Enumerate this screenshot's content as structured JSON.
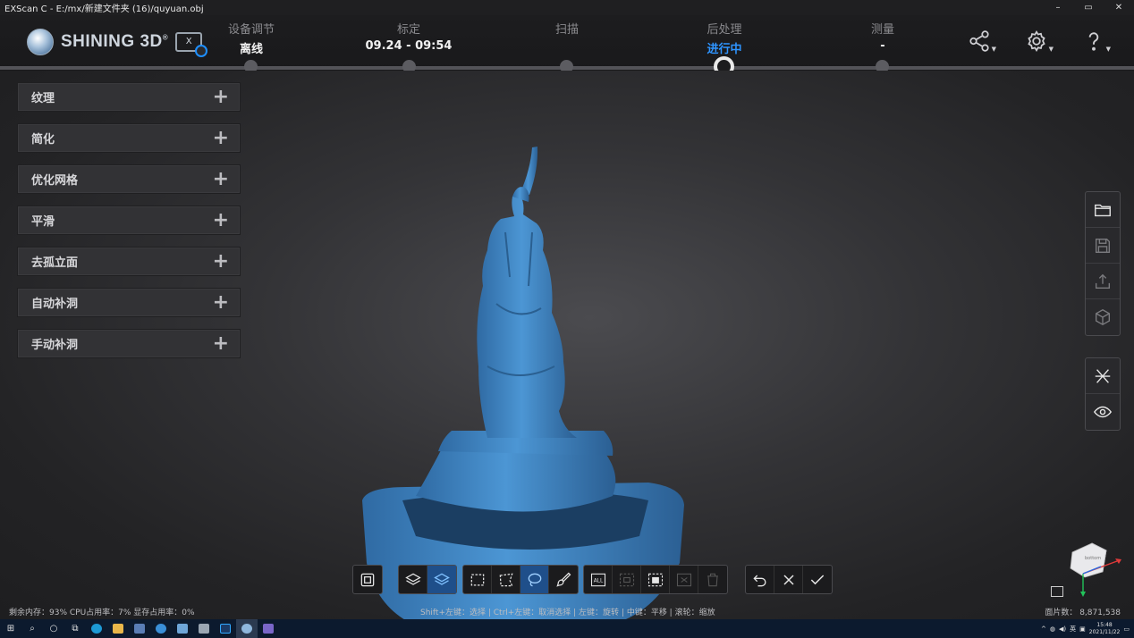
{
  "window": {
    "title": "EXScan C  -  E:/mx/新建文件夹 (16)/quyuan.obj",
    "controls": [
      "–",
      "▭",
      "✕"
    ]
  },
  "logo": {
    "brand": "SHINING 3D",
    "mark": "®"
  },
  "steps": [
    {
      "label": "设备调节",
      "value": "离线",
      "active": false
    },
    {
      "label": "标定",
      "value": "09.24 - 09:54",
      "active": false
    },
    {
      "label": "扫描",
      "value": "",
      "active": false
    },
    {
      "label": "后处理",
      "value": "进行中",
      "active": true
    },
    {
      "label": "测量",
      "value": "-",
      "active": false
    }
  ],
  "header_icons": [
    "share-icon",
    "gear-icon",
    "help-icon"
  ],
  "tools": [
    {
      "label": "纹理",
      "action": "+"
    },
    {
      "label": "简化",
      "action": "+"
    },
    {
      "label": "优化网格",
      "action": "+"
    },
    {
      "label": "平滑",
      "action": "+"
    },
    {
      "label": "去孤立面",
      "action": "+"
    },
    {
      "label": "自动补洞",
      "action": "+"
    },
    {
      "label": "手动补洞",
      "action": "+"
    }
  ],
  "right_panel_top": [
    "folder-icon",
    "save-icon",
    "export-icon",
    "cube-icon"
  ],
  "right_panel_bottom": [
    "mesh-icon",
    "eye-icon"
  ],
  "bottom_toolbar": {
    "groups": [
      [
        "view-fit-icon"
      ],
      [
        "layers-icon",
        "layers-selected-icon"
      ],
      [
        "rect-select-icon",
        "polygon-select-icon",
        "lasso-select-icon",
        "brush-select-icon"
      ],
      [
        "select-all-icon",
        "invert-select-icon",
        "select-connected-icon",
        "clear-select-icon",
        "delete-icon"
      ],
      [
        "undo-icon",
        "cancel-icon",
        "apply-icon"
      ]
    ]
  },
  "status": {
    "left": "剩余内存：93%  CPU占用率：7%  显存占用率：0%",
    "mid": "Shift+左键：选择 | Ctrl+左键：取消选择 | 左键：旋转 | 中键：平移 | 滚轮：缩放",
    "right": "面片数：  8,871,538"
  },
  "navcube": {
    "face": "bottom"
  },
  "taskbar": {
    "clock_time": "15:48",
    "clock_date": "2021/11/22"
  },
  "colors": {
    "accent": "#2e94ff",
    "model": "#3f86c4"
  }
}
